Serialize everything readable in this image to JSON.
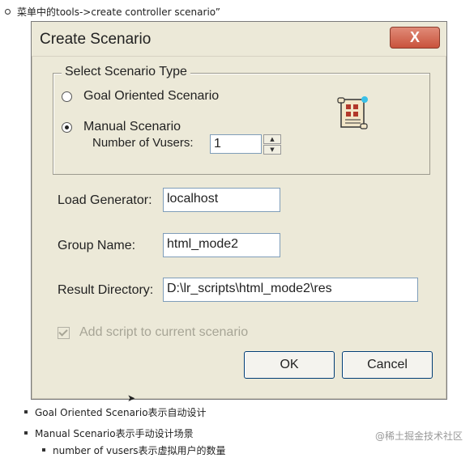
{
  "top_note": "菜单中的tools->create controller scenario”",
  "dialog": {
    "title": "Create Scenario",
    "close_label": "X",
    "scenario_type": {
      "legend": "Select Scenario Type",
      "option_goal": "Goal Oriented Scenario",
      "option_manual": "Manual Scenario",
      "selected": "Manual Scenario",
      "vusers_label": "Number of Vusers:",
      "vusers_value": "1"
    },
    "load_generator": {
      "label": "Load Generator:",
      "value": "localhost"
    },
    "group_name": {
      "label": "Group Name:",
      "value": "html_mode2"
    },
    "result_directory": {
      "label": "Result Directory:",
      "value": "D:\\lr_scripts\\html_mode2\\res"
    },
    "add_script_label": "Add script to current scenario",
    "ok_label": "OK",
    "cancel_label": "Cancel"
  },
  "bullets": {
    "item1": "Goal Oriented Scenario表示自动设计",
    "item2": "Manual Scenario表示手动设计场景",
    "item3": "number of vusers表示虚拟用户的数量"
  },
  "watermark": "@稀土掘金技术社区"
}
